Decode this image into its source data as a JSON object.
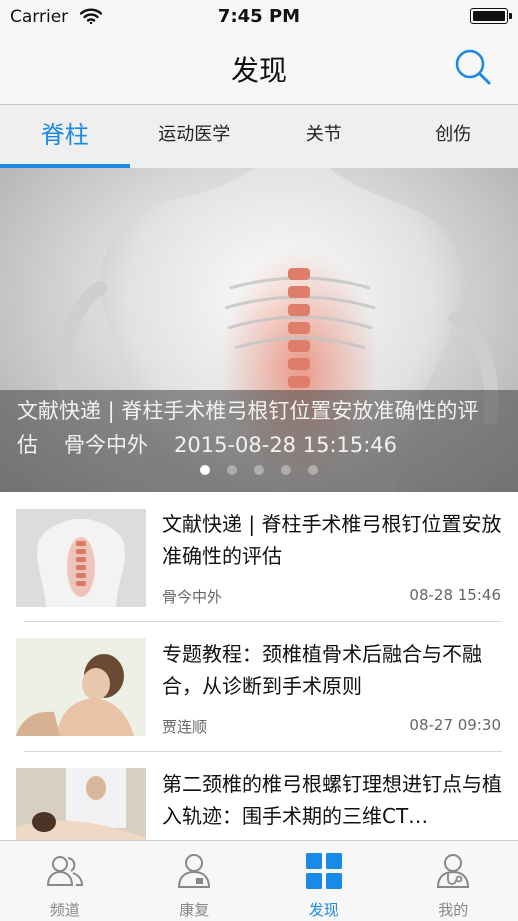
{
  "status_bar": {
    "carrier": "Carrier",
    "time": "7:45 PM"
  },
  "nav": {
    "title": "发现"
  },
  "category_tabs": [
    {
      "label": "脊柱"
    },
    {
      "label": "运动医学"
    },
    {
      "label": "关节"
    },
    {
      "label": "创伤"
    }
  ],
  "banner": {
    "title": "文献快递 | 脊柱手术椎弓根钉位置安放准确性的评估",
    "source": "骨今中外",
    "datetime": "2015-08-28 15:15:46",
    "page_count": 5,
    "current_page": 1
  },
  "articles": [
    {
      "title": "文献快递 | 脊柱手术椎弓根钉位置安放准确性的评估",
      "source": "骨今中外",
      "time": "08-28 15:46"
    },
    {
      "title": "专题教程：颈椎植骨术后融合与不融合，从诊断到手术原则",
      "source": "贾连顺",
      "time": "08-27 09:30"
    },
    {
      "title": "第二颈椎的椎弓根螺钉理想进钉点与植入轨迹：围手术期的三维CT…",
      "source": "",
      "time": ""
    }
  ],
  "tabbar": [
    {
      "label": "频道",
      "icon": "people-icon"
    },
    {
      "label": "康复",
      "icon": "doctor-icon"
    },
    {
      "label": "发现",
      "icon": "grid-icon"
    },
    {
      "label": "我的",
      "icon": "stethoscope-person-icon"
    }
  ],
  "colors": {
    "accent": "#1a8ae6",
    "nav_background": "#f7f7f7"
  }
}
